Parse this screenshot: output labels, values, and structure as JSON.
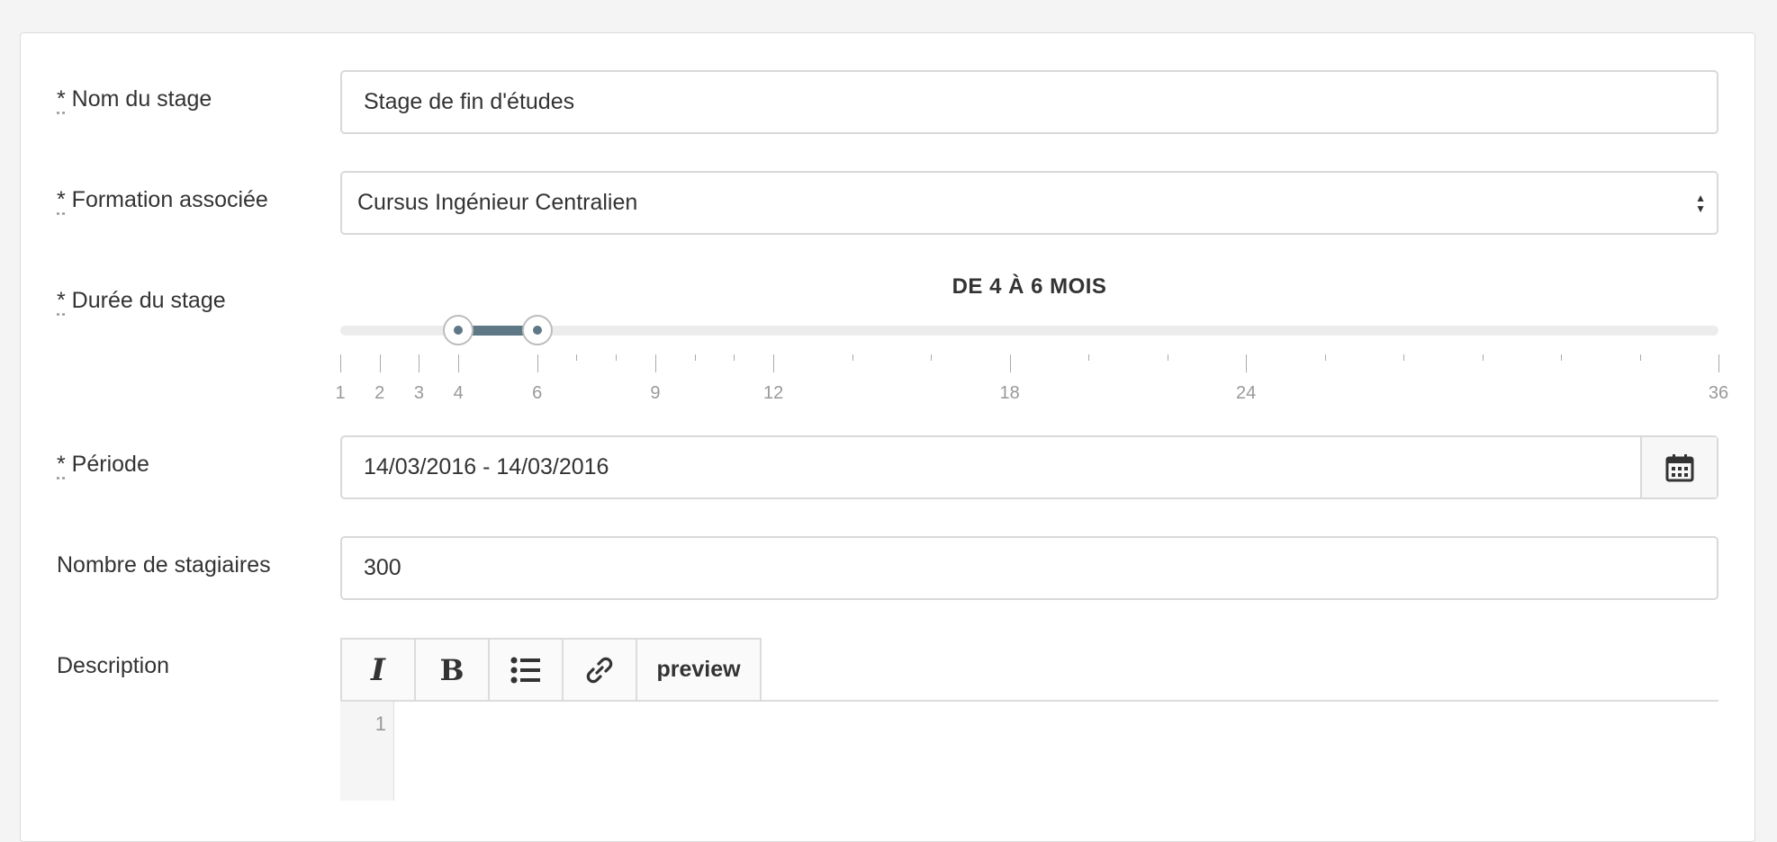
{
  "form": {
    "nom": {
      "label_req": "*",
      "label": " Nom du stage",
      "value": "Stage de fin d'études"
    },
    "formation": {
      "label_req": "*",
      "label": " Formation associée",
      "value": "Cursus Ingénieur Centralien"
    },
    "duree": {
      "label_req": "*",
      "label": " Durée du stage",
      "range_text": "DE 4 À 6 MOIS",
      "min": 1,
      "max": 36,
      "low": 4,
      "high": 6,
      "tick_labels": [
        "1",
        "2",
        "3",
        "4",
        "6",
        "9",
        "12",
        "18",
        "24",
        "36"
      ]
    },
    "periode": {
      "label_req": "*",
      "label": " Période",
      "value": "14/03/2016 - 14/03/2016",
      "icon": "calendar-icon"
    },
    "stagiaires": {
      "label": "Nombre de stagiaires",
      "value": "300"
    },
    "description": {
      "label": "Description",
      "toolbar": {
        "italic": "I",
        "bold": "B",
        "list": "list-icon",
        "link": "link-icon",
        "preview": "preview"
      },
      "line_number": "1"
    }
  },
  "colors": {
    "accent": "#5f7886",
    "border": "#d9d9d9",
    "background": "#f4f4f4"
  }
}
